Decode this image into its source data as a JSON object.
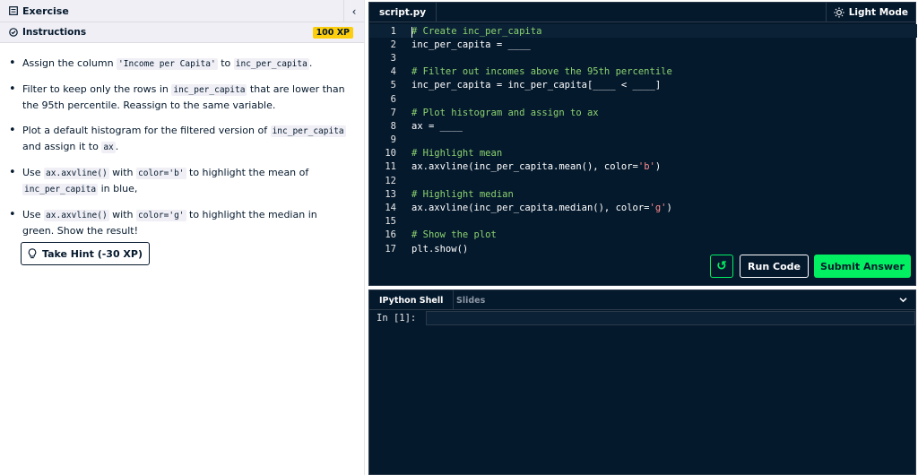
{
  "exercise": {
    "header_label": "Exercise",
    "collapse_glyph": "‹",
    "instructions_label": "Instructions",
    "xp_badge": "100 XP",
    "tasks": [
      {
        "t1": "Assign the column ",
        "c1": "'Income per Capita'",
        "t2": " to ",
        "c2": "inc_per_capita",
        "t3": "."
      },
      {
        "t1": "Filter to keep only the rows in ",
        "c1": "inc_per_capita",
        "t2": " that are lower than the 95th percentile. Reassign to the same variable."
      },
      {
        "t1": "Plot a default histogram for the filtered version of ",
        "c1": "inc_per_capita",
        "t2": " and assign it to ",
        "c2": "ax",
        "t3": "."
      },
      {
        "t1": "Use ",
        "c1": "ax.axvline()",
        "t2": " with ",
        "c2": "color='b'",
        "t3": " to highlight the mean of ",
        "c3": "inc_per_capita",
        "t4": " in blue,"
      },
      {
        "t1": "Use ",
        "c1": "ax.axvline()",
        "t2": " with ",
        "c2": "color='g'",
        "t3": " to highlight the median in green. Show the result!"
      }
    ],
    "hint_button": "Take Hint (-30 XP)"
  },
  "editor": {
    "tab": "script.py",
    "light_mode": "Light Mode",
    "lines": [
      {
        "n": "1",
        "cm": "# Create inc_per_capita"
      },
      {
        "n": "2",
        "code": "inc_per_capita = ____"
      },
      {
        "n": "3",
        "code": ""
      },
      {
        "n": "4",
        "cm": "# Filter out incomes above the 95th percentile"
      },
      {
        "n": "5",
        "code": "inc_per_capita = inc_per_capita[____ < ____]"
      },
      {
        "n": "6",
        "code": ""
      },
      {
        "n": "7",
        "cm": "# Plot histogram and assign to ax"
      },
      {
        "n": "8",
        "code": "ax = ____"
      },
      {
        "n": "9",
        "code": ""
      },
      {
        "n": "10",
        "cm": "# Highlight mean"
      },
      {
        "n": "11",
        "pre": "ax.axvline(inc_per_capita.mean(), color=",
        "str": "'b'",
        "post": ")"
      },
      {
        "n": "12",
        "code": ""
      },
      {
        "n": "13",
        "cm": "# Highlight median"
      },
      {
        "n": "14",
        "pre": "ax.axvline(inc_per_capita.median(), color=",
        "str": "'g'",
        "post": ")"
      },
      {
        "n": "15",
        "code": ""
      },
      {
        "n": "16",
        "cm": "# Show the plot"
      },
      {
        "n": "17",
        "code": "plt.show()"
      }
    ],
    "reset_glyph": "↺",
    "run_button": "Run Code",
    "submit_button": "Submit Answer"
  },
  "shell": {
    "tab_active": "IPython Shell",
    "tab_inactive": "Slides",
    "chevron": "⌄",
    "prompt": "In [1]:"
  },
  "colors": {
    "accent_green": "#03ef62",
    "navy": "#05192d",
    "xp_yellow": "#fcce0d",
    "comment": "#8bd26f",
    "string": "#ff8c8c"
  }
}
